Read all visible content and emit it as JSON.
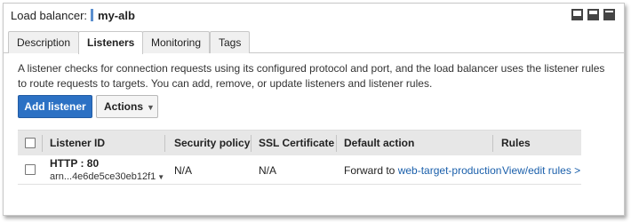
{
  "header": {
    "label": "Load balancer:",
    "name": "my-alb"
  },
  "tabs": [
    {
      "label": "Description",
      "active": false
    },
    {
      "label": "Listeners",
      "active": true
    },
    {
      "label": "Monitoring",
      "active": false
    },
    {
      "label": "Tags",
      "active": false
    }
  ],
  "description": "A listener checks for connection requests using its configured protocol and port, and the load balancer uses the listener rules to route requests to targets. You can add, remove, or update listeners and listener rules.",
  "actions": {
    "add_label": "Add listener",
    "actions_label": "Actions"
  },
  "table": {
    "columns": [
      "Listener ID",
      "Security policy",
      "SSL Certificate",
      "Default action",
      "Rules"
    ],
    "rows": [
      {
        "protocol": "HTTP : 80",
        "arn": "arn...4e6de5ce30eb12f1",
        "security_policy": "N/A",
        "ssl_certificate": "N/A",
        "default_action_prefix": "Forward to",
        "default_action_target": "web-target-production",
        "rules_link": "View/edit rules >"
      }
    ]
  },
  "icons": [
    "panel-layout-icon",
    "panel-layout-icon",
    "panel-layout-icon",
    "checkbox",
    "dropdown-caret-icon"
  ],
  "colors": {
    "primary_button": "#2c71c4",
    "link": "#1a5fab",
    "table_header": "#e7e7e7"
  }
}
